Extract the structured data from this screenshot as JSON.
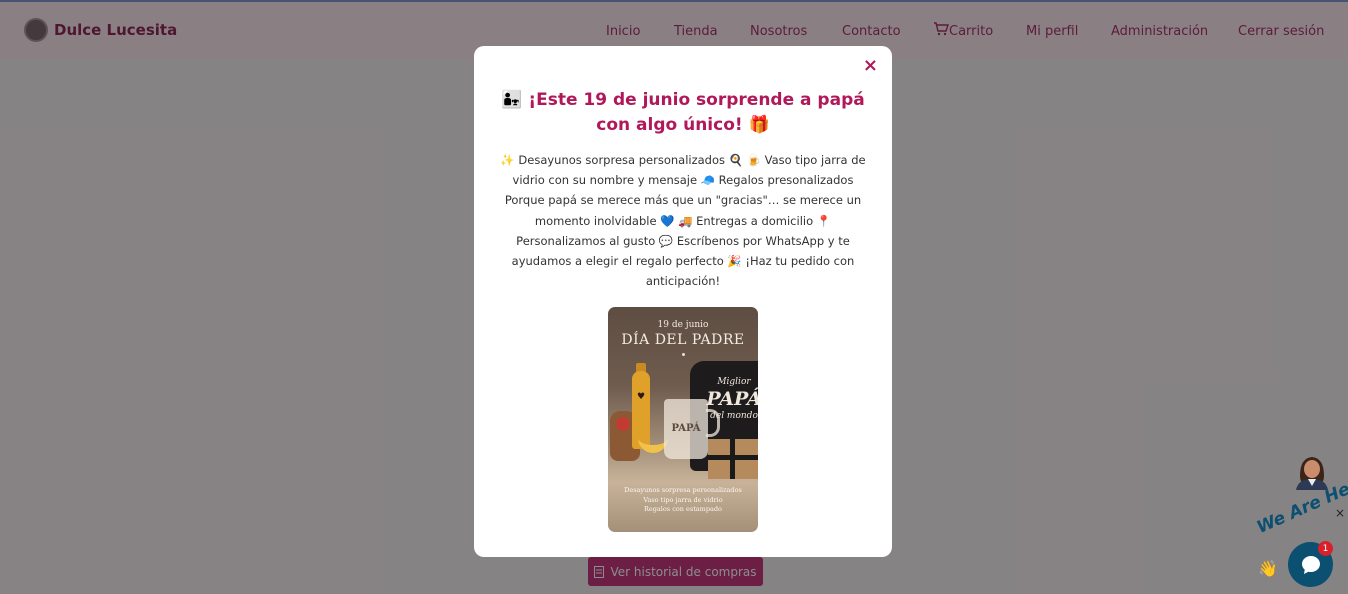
{
  "navbar": {
    "brand": "Dulce Lucesita",
    "links": [
      "Inicio",
      "Tienda",
      "Nosotros",
      "Contacto",
      "Carrito",
      "Mi perfil",
      "Administración",
      "Cerrar sesión"
    ]
  },
  "page": {
    "history_button": "Ver historial de compras"
  },
  "modal": {
    "close_label": "×",
    "title": "👨‍👧 ¡Este 19 de junio sorprende a papá con algo único! 🎁",
    "body": "✨ Desayunos sorpresa personalizados 🍳 🍺 Vaso tipo jarra de vidrio con su nombre y mensaje 🧢 Regalos presonalizados Porque papá se merece más que un \"gracias\"… se merece un momento inolvidable 💙 🚚 Entregas a domicilio 📍 Personalizamos al gusto 💬 Escríbenos por WhatsApp y te ayudamos a elegir el regalo perfecto 🎉 ¡Haz tu pedido con anticipación!",
    "image": {
      "date": "19 de junio",
      "heading": "DÍA DEL PADRE",
      "shirt_line1": "Miglior",
      "shirt_line2": "PAPÁ",
      "shirt_line3": "del mondo",
      "jar_text": "PAPÁ",
      "footer_line1": "Desayunos sorpresa personalizados",
      "footer_line2": "Vaso tipo jarra de vidrio",
      "footer_line3": "Regalos con estampado"
    }
  },
  "chat_widget": {
    "close_label": "×",
    "tagline": "We Are Here!",
    "badge_count": "1"
  },
  "colors": {
    "brand": "#8e2b57",
    "accent": "#b0185a",
    "button": "#c5387f",
    "chat": "#0b4f71"
  }
}
